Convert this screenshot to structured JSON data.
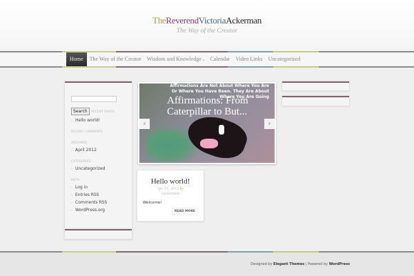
{
  "site": {
    "title_parts": [
      {
        "text": "The",
        "color": "#a3a24a"
      },
      {
        "text": "Reverend",
        "color": "#8a3a7a"
      },
      {
        "text": "Victoria",
        "color": "#4a5f8a"
      },
      {
        "text": "Ackerman",
        "color": "#222222"
      }
    ],
    "tagline": "The Way of the Creator"
  },
  "nav": {
    "items": [
      "Home",
      "The Way of the Creator",
      "Wisdom and Knowledge",
      "Calendar",
      "Video Links",
      "Uncategorized"
    ],
    "dropdown_marker": "»"
  },
  "sidebar": {
    "search_button": "Search",
    "search_value": "",
    "recent_posts_title": "Recent Posts",
    "recent_posts": [
      "Hello world!"
    ],
    "recent_comments_title": "Recent Comments",
    "archives_title": "Archives",
    "archives": [
      "April 2012"
    ],
    "categories_title": "Categories",
    "categories": [
      "Uncategorized"
    ],
    "meta_title": "Meta",
    "meta": [
      "Log in",
      "Entries RSS",
      "Comments RSS",
      "WordPress.org"
    ]
  },
  "slider": {
    "caption_small": "Affirmations Are Not About Where You Are Or Where You Have Been.  They Are About Where You Are Going",
    "title": "Affirmations: From Caterpillar to But...",
    "prev": "‹",
    "next": "›"
  },
  "post": {
    "title": "Hello world!",
    "date": "Apr 21, 2012",
    "by": "by",
    "author": "vackerman",
    "excerpt": "Welcome!",
    "read_more": "Read More"
  },
  "footer": {
    "designed_by": "Designed by",
    "elegant": "Elegant Themes",
    "sep": "|",
    "powered_by": "Powered by",
    "wordpress": "WordPress"
  }
}
